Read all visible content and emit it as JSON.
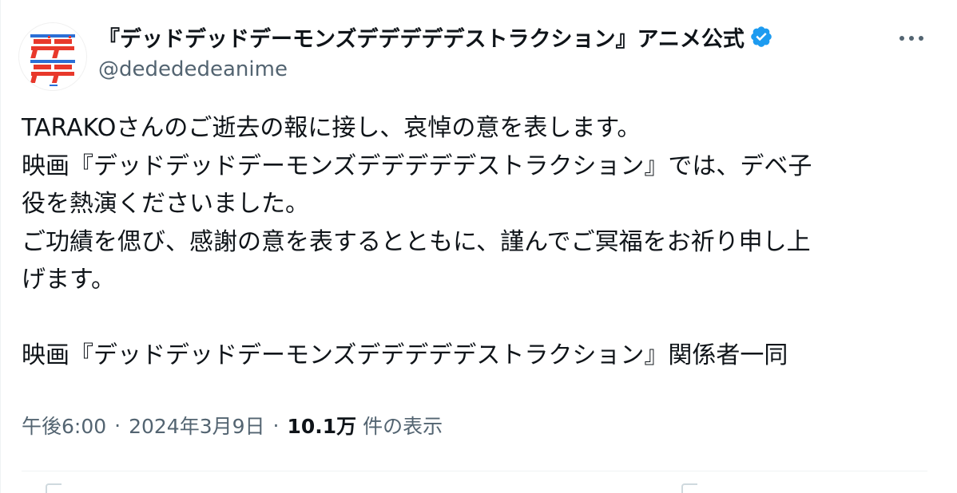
{
  "account": {
    "display_name": "『デッドデッドデーモンズデデデデデストラクション』アニメ公式",
    "handle": "@dedededeanime",
    "verified": true,
    "verified_color": "#1d9bf0"
  },
  "avatar": {
    "icon": "dedede-logo-icon",
    "colors": {
      "red": "#e8382b",
      "blue": "#2b6fd6"
    }
  },
  "menu": {
    "icon": "more-options-icon"
  },
  "tweet": {
    "lines": [
      "TARAKOさんのご逝去の報に接し、哀悼の意を表します。",
      "映画『デッドデッドデーモンズデデデデデストラクション』では、デベ子",
      "役を熱演くださいました。",
      "ご功績を偲び、感謝の意を表するとともに、謹んでご冥福をお祈り申し上",
      "げます。",
      "",
      "映画『デッドデッドデーモンズデデデデデストラクション』関係者一同"
    ]
  },
  "meta": {
    "time": "午後6:00",
    "separator": "·",
    "date": "2024年3月9日",
    "views_count": "10.1万",
    "views_label": "件の表示"
  }
}
